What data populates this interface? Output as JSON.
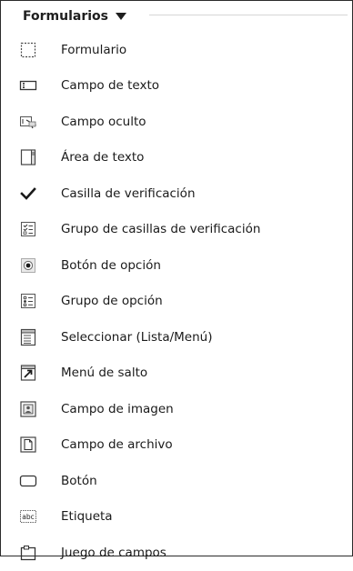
{
  "panel": {
    "category_label": "Formularios"
  },
  "items": [
    {
      "label": "Formulario",
      "icon": "form-icon"
    },
    {
      "label": "Campo de texto",
      "icon": "text-field-icon"
    },
    {
      "label": "Campo oculto",
      "icon": "hidden-field-icon"
    },
    {
      "label": "Área de texto",
      "icon": "textarea-icon"
    },
    {
      "label": "Casilla de verificación",
      "icon": "checkbox-icon"
    },
    {
      "label": "Grupo de casillas de verificación",
      "icon": "checkbox-group-icon"
    },
    {
      "label": "Botón de opción",
      "icon": "radio-button-icon"
    },
    {
      "label": "Grupo de opción",
      "icon": "radio-group-icon"
    },
    {
      "label": "Seleccionar (Lista/Menú)",
      "icon": "select-list-icon"
    },
    {
      "label": "Menú de salto",
      "icon": "jump-menu-icon"
    },
    {
      "label": "Campo de imagen",
      "icon": "image-field-icon"
    },
    {
      "label": "Campo de archivo",
      "icon": "file-field-icon"
    },
    {
      "label": "Botón",
      "icon": "button-icon"
    },
    {
      "label": "Etiqueta",
      "icon": "label-icon"
    },
    {
      "label": "Juego de campos",
      "icon": "fieldset-icon"
    }
  ],
  "icon_text": {
    "label_icon": "abc"
  }
}
